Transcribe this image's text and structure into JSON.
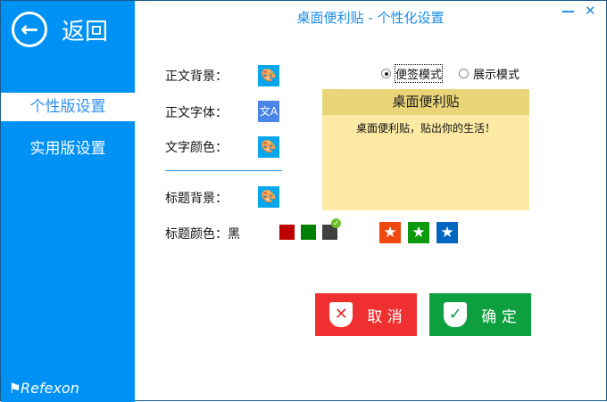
{
  "window": {
    "title": "桌面便利贴 - 个性化设置",
    "minimize": "—",
    "close": "✕"
  },
  "sidebar": {
    "back": "返回",
    "items": [
      {
        "label": "个性版设置"
      },
      {
        "label": "实用版设置"
      }
    ],
    "logo": "Refexon"
  },
  "settings": {
    "body_bg": "正文背景：",
    "body_font": "正文字体：",
    "text_color": "文字颜色：",
    "title_bg": "标题背景：",
    "title_color": "标题颜色：黑"
  },
  "swatches": [
    "#c00000",
    "#008000",
    "#404040"
  ],
  "stars": [
    "#f0480e",
    "#0c9a0c",
    "#0066c0"
  ],
  "modes": {
    "note": "便签模式",
    "display": "展示模式"
  },
  "preview": {
    "title": "桌面便利贴",
    "body": "桌面便利贴，贴出你的生活！"
  },
  "buttons": {
    "cancel": "取 消",
    "ok": "确 定"
  }
}
